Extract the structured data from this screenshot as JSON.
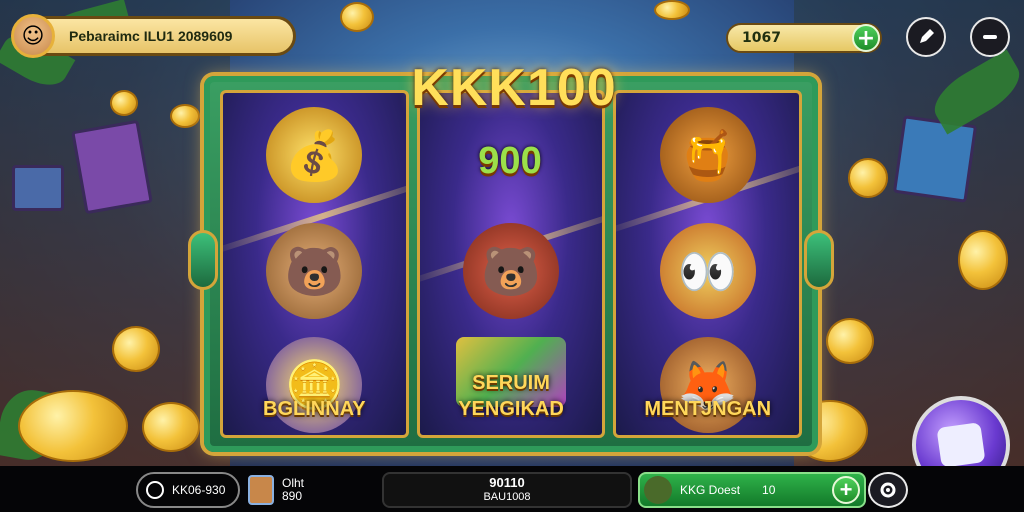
{
  "header": {
    "player_text": "Pebaraimc ILU1 2089609",
    "avatar_icon": "☺",
    "balance": "1067"
  },
  "machine": {
    "title": "KKK100",
    "subtitle": "900",
    "reels": [
      {
        "label": "BGLINNAY",
        "top_symbol": "coin-stack-icon",
        "mid_symbol": "bear-icon",
        "bot_symbol": "gold-coin-orb-icon"
      },
      {
        "label": "SERUIM YENGIKAD",
        "label_line1": "SERUIM",
        "label_line2": "YENGIKAD",
        "top_symbol": "lightning-icon",
        "mid_symbol": "bear-face-icon",
        "bot_symbol": "gem-blocks-icon"
      },
      {
        "label": "MENTJNGAN",
        "top_symbol": "bowl-icon",
        "mid_symbol": "eyes-ball-icon",
        "bot_symbol": "fox-icon"
      }
    ]
  },
  "bottom": {
    "left_label": "KK06-930",
    "mid_small_top": "Olht",
    "mid_small_bottom": "890",
    "center_top": "90110",
    "center_bottom": "BAU1008",
    "right_label": "KKG Doest",
    "right_value": "10"
  },
  "colors": {
    "accent_green": "#2f9a5a",
    "gold": "#ffd75a",
    "frame_gold": "#d4a53a",
    "plus_green": "#1f8d2a"
  }
}
